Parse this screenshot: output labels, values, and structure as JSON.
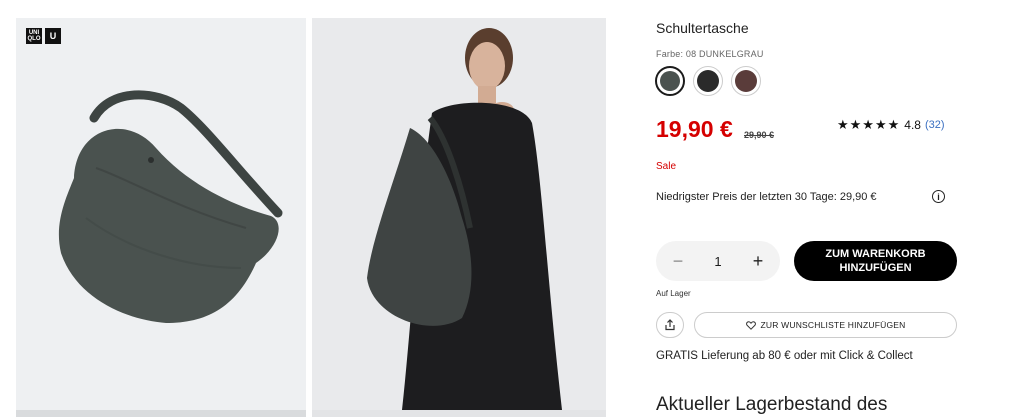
{
  "brand": {
    "logo_top": "UNI QLO",
    "logo_letter": "U"
  },
  "product": {
    "name": "Schultertasche",
    "color_label": "Farbe: 08 DUNKELGRAU",
    "swatches": [
      {
        "name": "dark-grey",
        "color": "#4a524f",
        "selected": true
      },
      {
        "name": "black",
        "color": "#2a2a2a",
        "selected": false
      },
      {
        "name": "brown",
        "color": "#5a3c3a",
        "selected": false
      }
    ],
    "price": "19,90 €",
    "old_price": "29,90 €",
    "rating_stars": "★★★★★",
    "rating_value": "4.8",
    "rating_count": "(32)",
    "sale_label": "Sale",
    "lowest_price_text": "Niedrigster Preis der letzten 30 Tage: 29,90 €",
    "info_icon": "i"
  },
  "purchase": {
    "qty_minus": "−",
    "qty_value": "1",
    "qty_plus": "+",
    "add_to_cart": "ZUM WARENKORB HINZUFÜGEN",
    "stock_status": "Auf Lager",
    "wishlist": "ZUR WUNSCHLISTE HINZUFÜGEN",
    "wishlist_icon": "heart-icon",
    "share_icon": "share-icon"
  },
  "delivery_text": "GRATIS Lieferung ab 80 € oder mit Click & Collect",
  "stock_heading": "Aktueller Lagerbestand des",
  "colors": {
    "price_red": "#d50000",
    "button_black": "#000000",
    "link_blue": "#3a6fc1"
  }
}
